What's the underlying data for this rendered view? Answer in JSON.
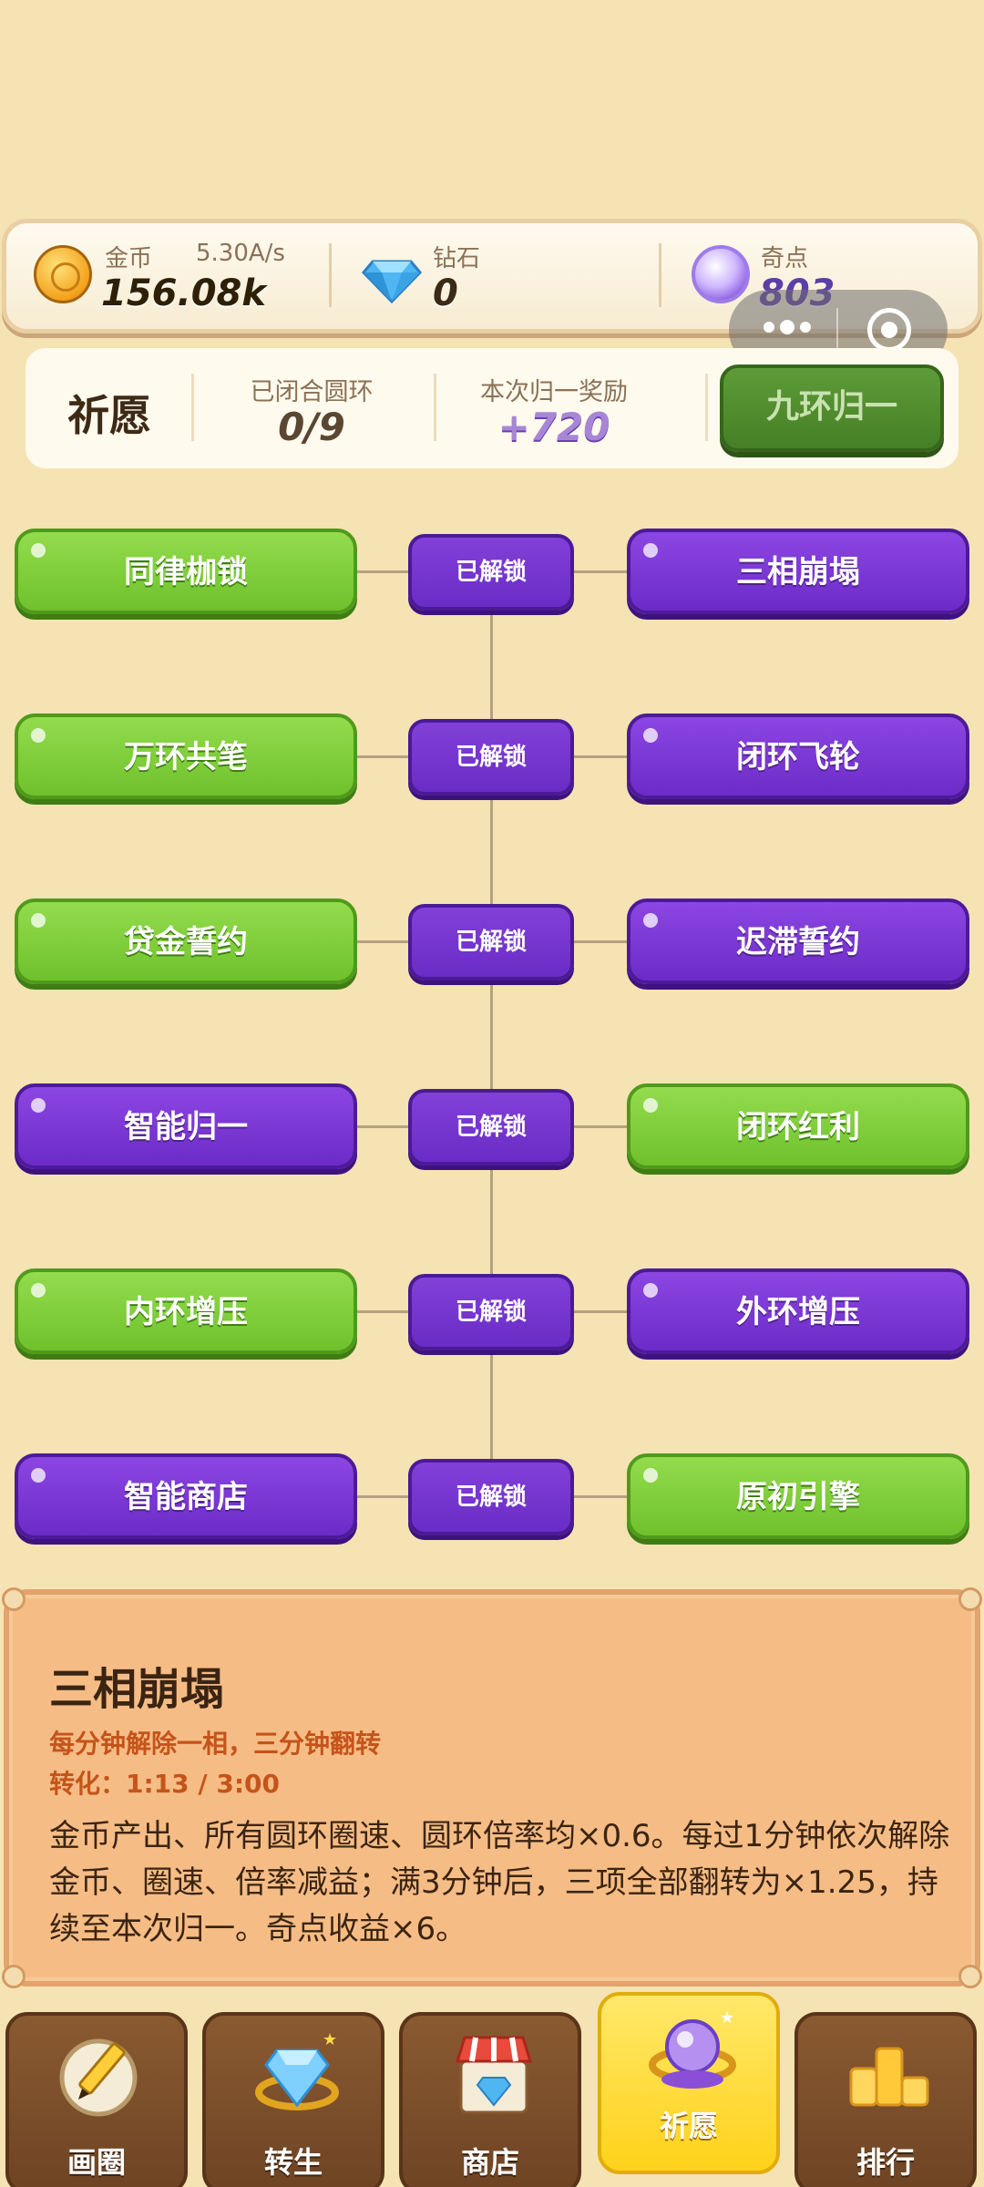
{
  "resources": {
    "gold": {
      "label": "金币",
      "rate": "5.30A/s",
      "value": "156.08k",
      "icon": "gold-coin-icon"
    },
    "diamond": {
      "label": "钻石",
      "value": "0",
      "icon": "diamond-icon"
    },
    "odd": {
      "label": "奇点",
      "value": "803",
      "icon": "purple-orb-icon"
    }
  },
  "wish": {
    "title": "祈愿",
    "closed_label": "已闭合圆环",
    "closed_value": "0/9",
    "reward_label": "本次归一奖励",
    "reward_value": "+720",
    "button_label": "九环归一"
  },
  "tree": {
    "rows": [
      {
        "left": "同律枷锁",
        "left_color": "green",
        "mid": "已解锁",
        "right": "三相崩塌",
        "right_color": "purple"
      },
      {
        "left": "万环共笔",
        "left_color": "green",
        "mid": "已解锁",
        "right": "闭环飞轮",
        "right_color": "purple"
      },
      {
        "left": "贷金誓约",
        "left_color": "green",
        "mid": "已解锁",
        "right": "迟滞誓约",
        "right_color": "purple"
      },
      {
        "left": "智能归一",
        "left_color": "purple",
        "mid": "已解锁",
        "right": "闭环红利",
        "right_color": "green"
      },
      {
        "left": "内环增压",
        "left_color": "green",
        "mid": "已解锁",
        "right": "外环增压",
        "right_color": "purple"
      },
      {
        "left": "智能商店",
        "left_color": "purple",
        "mid": "已解锁",
        "right": "原初引擎",
        "right_color": "green"
      }
    ]
  },
  "detail": {
    "title": "三相崩塌",
    "subtitle": "每分钟解除一相，三分钟翻转",
    "progress": "转化：1:13 / 3:00",
    "body": "金币产出、所有圆环圈速、圆环倍率均×0.6。每过1分钟依次解除金币、圈速、倍率减益；满3分钟后，三项全部翻转为×1.25，持续至本次归一。奇点收益×6。"
  },
  "nav": [
    {
      "label": "画圈",
      "icon": "pencil-icon"
    },
    {
      "label": "转生",
      "icon": "diamond-ring-icon"
    },
    {
      "label": "商店",
      "icon": "shop-icon"
    },
    {
      "label": "祈愿",
      "icon": "wish-orb-icon",
      "active": true
    },
    {
      "label": "排行",
      "icon": "rank-podium-icon"
    }
  ],
  "colors": {
    "background": "#f5e3b3",
    "green": "#7ccc36",
    "purple": "#7a34d6",
    "dark_green_button": "#4f8c2d",
    "panel": "#f5bd85",
    "nav_active": "#ffd21a",
    "nav_tab": "#7a4c2a"
  }
}
